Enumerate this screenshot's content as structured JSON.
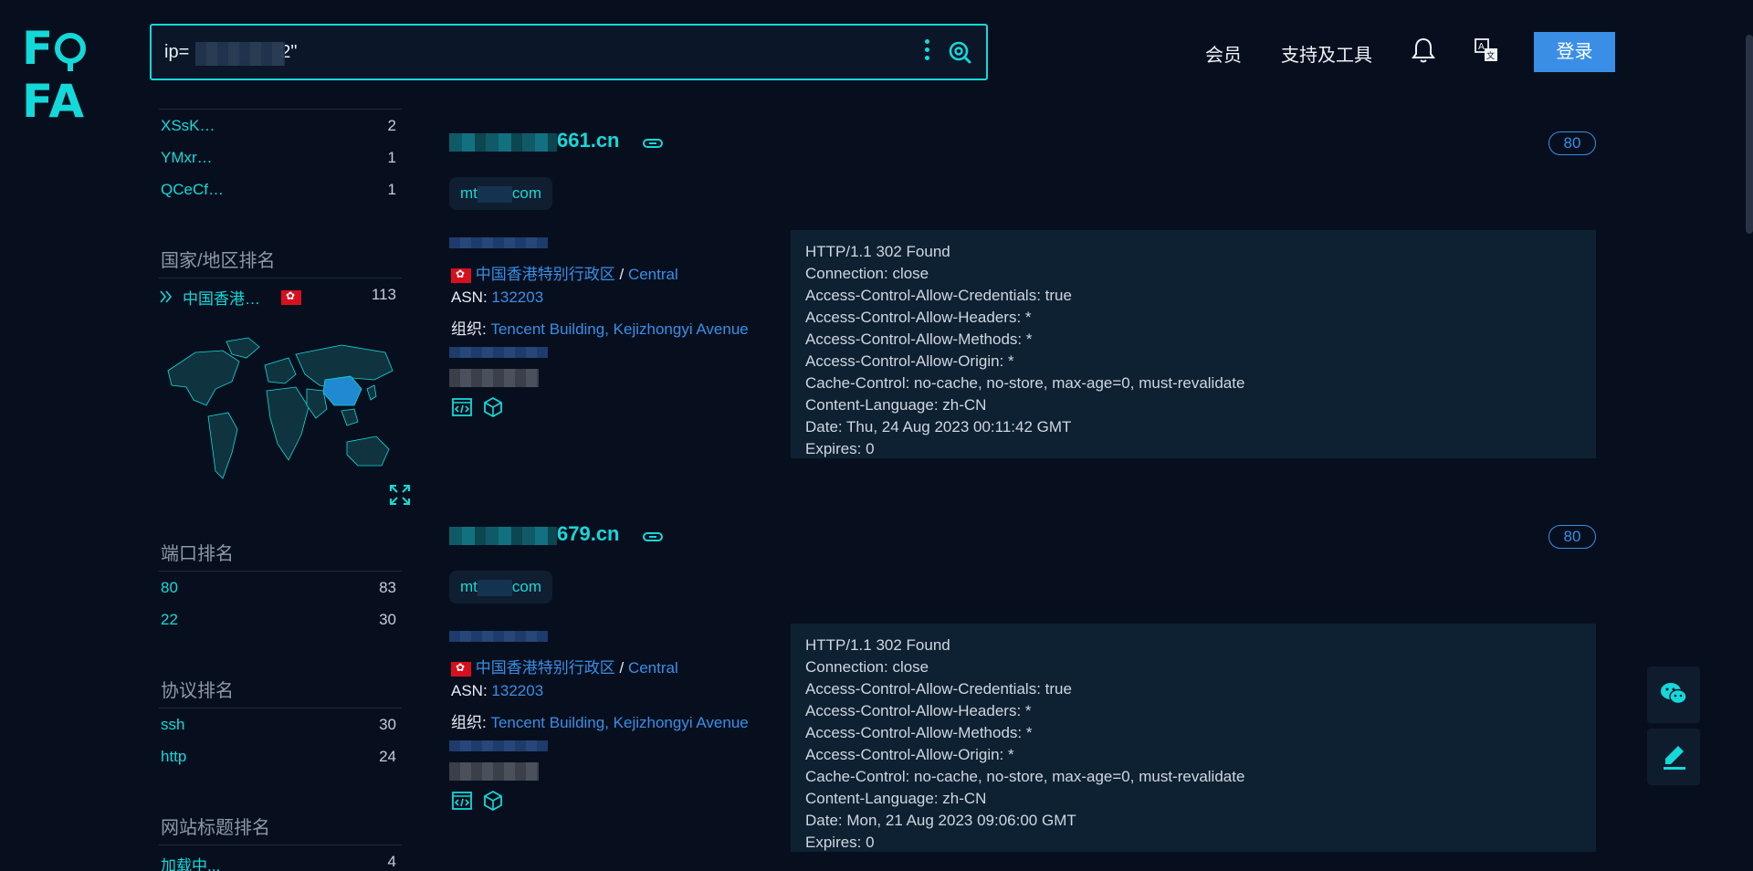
{
  "header": {
    "logo": "FOFA",
    "search_value": "ip=                  2\"",
    "nav_member": "会员",
    "nav_tools": "支持及工具",
    "login": "登录"
  },
  "sidebar": {
    "top_items": [
      {
        "label": "XSsK…",
        "count": "2"
      },
      {
        "label": "YMxr…",
        "count": "1"
      },
      {
        "label": "QCeCf…",
        "count": "1"
      }
    ],
    "country_title": "国家/地区排名",
    "country_item": {
      "label": "中国香港…",
      "count": "113"
    },
    "port_title": "端口排名",
    "ports": [
      {
        "label": "80",
        "count": "83"
      },
      {
        "label": "22",
        "count": "30"
      }
    ],
    "protocol_title": "协议排名",
    "protocols": [
      {
        "label": "ssh",
        "count": "30"
      },
      {
        "label": "http",
        "count": "24"
      }
    ],
    "site_title_title": "网站标题排名",
    "site_titles": [
      {
        "label": "加载中...",
        "count": "4"
      }
    ]
  },
  "results": [
    {
      "title_suffix": "661.cn",
      "port": "80",
      "subdomain_prefix": "mt",
      "subdomain_suffix": "com",
      "region": "中国香港特别行政区",
      "separator": "/",
      "city": "Central",
      "asn_label": "ASN:",
      "asn": "132203",
      "org_label": "组织:",
      "org": "Tencent Building, Kejizhongyi Avenue",
      "headers": [
        "HTTP/1.1 302 Found",
        "Connection: close",
        "Access-Control-Allow-Credentials: true",
        "Access-Control-Allow-Headers: *",
        "Access-Control-Allow-Methods: *",
        "Access-Control-Allow-Origin: *",
        "Cache-Control: no-cache, no-store, max-age=0, must-revalidate",
        "Content-Language: zh-CN",
        "Date: Thu, 24 Aug 2023 00:11:42 GMT",
        "Expires: 0"
      ]
    },
    {
      "title_suffix": "679.cn",
      "port": "80",
      "subdomain_prefix": "mt",
      "subdomain_suffix": "com",
      "region": "中国香港特别行政区",
      "separator": "/",
      "city": "Central",
      "asn_label": "ASN:",
      "asn": "132203",
      "org_label": "组织:",
      "org": "Tencent Building, Kejizhongyi Avenue",
      "headers": [
        "HTTP/1.1 302 Found",
        "Connection: close",
        "Access-Control-Allow-Credentials: true",
        "Access-Control-Allow-Headers: *",
        "Access-Control-Allow-Methods: *",
        "Access-Control-Allow-Origin: *",
        "Cache-Control: no-cache, no-store, max-age=0, must-revalidate",
        "Content-Language: zh-CN",
        "Date: Mon, 21 Aug 2023 09:06:00 GMT",
        "Expires: 0"
      ]
    }
  ],
  "colors": {
    "accent": "#14d9d9",
    "link": "#3a8ee6",
    "background": "#070f1e",
    "panel": "#0e2132"
  }
}
